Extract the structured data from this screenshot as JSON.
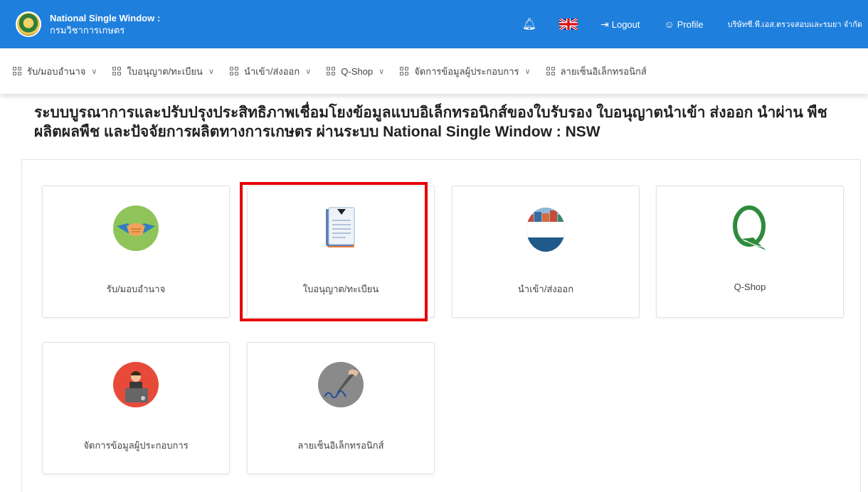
{
  "header": {
    "app_title_line1": "National Single Window :",
    "app_title_line2": "กรมวิชาการเกษตร",
    "logout_label": "Logout",
    "profile_label": "Profile",
    "company_name": "บริษัทซี.พี.เอส.ตรวจสอบและรมยา จำกัด"
  },
  "nav": {
    "items": [
      {
        "label": "รับ/มอบอำนาจ",
        "has_dropdown": true
      },
      {
        "label": "ใบอนุญาต/ทะเบียน",
        "has_dropdown": true
      },
      {
        "label": "นำเข้า/ส่งออก",
        "has_dropdown": true
      },
      {
        "label": "Q-Shop",
        "has_dropdown": true
      },
      {
        "label": "จัดการข้อมูลผู้ประกอบการ",
        "has_dropdown": true
      },
      {
        "label": "ลายเซ็นอิเล็กทรอนิกส์",
        "has_dropdown": false
      }
    ]
  },
  "page": {
    "title_line1": "ระบบบูรณาการและปรับปรุงประสิทธิภาพเชื่อมโยงข้อมูลแบบอิเล็กทรอนิกส์ของใบรับรอง ใบอนุญาตนำเข้า ส่งออก นำผ่าน พืช",
    "title_line2": "ผลิตผลพืช และปัจจัยการผลิตทางการเกษตร ผ่านระบบ National Single Window : NSW"
  },
  "cards": [
    {
      "label": "รับ/มอบอำนาจ",
      "icon": "handshake-icon"
    },
    {
      "label": "ใบอนุญาต/ทะเบียน",
      "icon": "document-icon",
      "highlighted": true
    },
    {
      "label": "นำเข้า/ส่งออก",
      "icon": "cargo-ship-icon"
    },
    {
      "label": "Q-Shop",
      "icon": "q-logo-icon"
    },
    {
      "label": "จัดการข้อมูลผู้ประกอบการ",
      "icon": "operator-icon"
    },
    {
      "label": "ลายเซ็นอิเล็กทรอนิกส์",
      "icon": "signature-icon"
    }
  ],
  "colors": {
    "header_bg": "#1f7fdc",
    "highlight_border": "#e60000"
  }
}
